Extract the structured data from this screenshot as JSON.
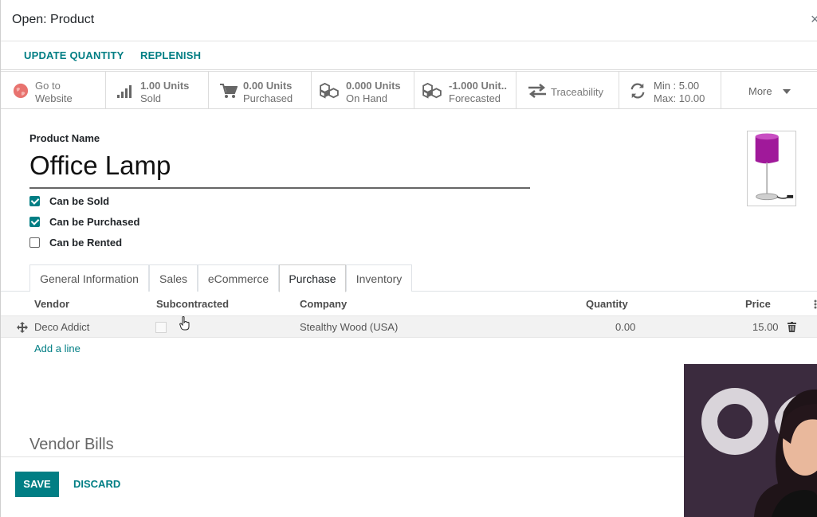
{
  "dialog": {
    "title": "Open: Product",
    "close_glyph": "×"
  },
  "status_bar": {
    "update_quantity": "UPDATE QUANTITY",
    "replenish": "REPLENISH"
  },
  "smart_buttons": [
    {
      "icon": "globe-icon",
      "line1": "Go to",
      "line2": "Website"
    },
    {
      "icon": "bar-chart-icon",
      "line1": "1.00 Units",
      "line2": "Sold"
    },
    {
      "icon": "cart-icon",
      "line1": "0.00 Units",
      "line2": "Purchased"
    },
    {
      "icon": "cubes-icon",
      "line1": "0.000 Units",
      "line2": "On Hand"
    },
    {
      "icon": "cubes-icon",
      "line1": "-1.000 Unit..",
      "line2": "Forecasted"
    },
    {
      "icon": "exchange-icon",
      "line1": "Traceability",
      "line2": ""
    },
    {
      "icon": "refresh-icon",
      "line1": "Min :  5.00",
      "line2": "Max:  10.00"
    },
    {
      "icon": "caret-down-icon",
      "line1": "More",
      "line2": ""
    }
  ],
  "product": {
    "name_label": "Product Name",
    "name": "Office Lamp",
    "image_icon": "lamp-image"
  },
  "checkboxes": [
    {
      "label": "Can be Sold",
      "checked": true
    },
    {
      "label": "Can be Purchased",
      "checked": true
    },
    {
      "label": "Can be Rented",
      "checked": false
    }
  ],
  "tabs": [
    {
      "label": "General Information",
      "active": false
    },
    {
      "label": "Sales",
      "active": false
    },
    {
      "label": "eCommerce",
      "active": false
    },
    {
      "label": "Purchase",
      "active": true
    },
    {
      "label": "Inventory",
      "active": false
    }
  ],
  "vendor_table": {
    "columns": [
      "Vendor",
      "Subcontracted",
      "Company",
      "Quantity",
      "Price"
    ],
    "rows": [
      {
        "vendor": "Deco Addict",
        "subcontracted": false,
        "company": "Stealthy Wood (USA)",
        "quantity": "0.00",
        "price": "15.00"
      }
    ],
    "add_line": "Add a line"
  },
  "vendor_bills_title": "Vendor Bills",
  "footer": {
    "save": "SAVE",
    "discard": "DISCARD"
  },
  "colors": {
    "primary": "#017e84",
    "lamp_shade": "#a0199a"
  }
}
